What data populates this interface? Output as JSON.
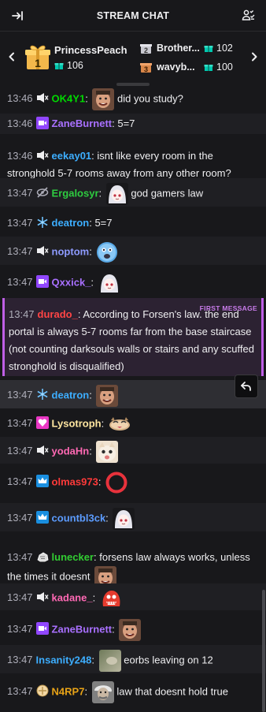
{
  "header": {
    "title": "STREAM CHAT"
  },
  "gifters": {
    "top": {
      "name": "PrincessPeach",
      "count": "106",
      "rank": "1"
    },
    "second": {
      "name": "Brother...",
      "count": "102",
      "rank": "2"
    },
    "third": {
      "name": "wavyb...",
      "count": "100",
      "rank": "3"
    }
  },
  "colors": {
    "accent": "#9147ff",
    "first_message": "#bf5fe6",
    "gift": "#00c8af"
  },
  "messages": [
    {
      "time": "13:46",
      "user": "OK4Y1",
      "user_color": "#00d900",
      "sep": ": ",
      "text": "did you study?",
      "badge": "mute-badge-icon",
      "emote": "face-emote"
    },
    {
      "time": "13:46",
      "user": "ZaneBurnett",
      "user_color": "#a970ff",
      "sep": ": ",
      "text": "5=7",
      "badge": "video-badge-icon"
    },
    {
      "time": "13:46",
      "user": "eekay01",
      "user_color": "#3daeff",
      "sep": ": ",
      "text": "isnt like every room in the stronghold 5-7 rooms away from any other room?",
      "badge": "mute-badge-icon"
    },
    {
      "time": "13:47",
      "user": "Ergalosyr",
      "user_color": "#2ecc40",
      "sep": ": ",
      "text": "god gamers law",
      "badge": "eye-slash-badge-icon",
      "emote": "anime-emote"
    },
    {
      "time": "13:47",
      "user": "deatron",
      "user_color": "#3daeff",
      "sep": ": ",
      "text": "5=7",
      "badge": "snowflake-badge-icon"
    },
    {
      "time": "13:47",
      "user": "noptom",
      "user_color": "#8e9bff",
      "sep": ": ",
      "text": "",
      "badge": "mute-badge-icon",
      "emote": "blue-blob-emote"
    },
    {
      "time": "13:47",
      "user": "Qxxick_",
      "user_color": "#a970ff",
      "sep": ": ",
      "text": "",
      "badge": "video-badge-icon",
      "emote": "anime-emote"
    },
    {
      "time": "13:47",
      "user": "durado_",
      "user_color": "#ff4545",
      "sep": ": ",
      "text": "According to Forsen's law. the end portal is always 5-7 rooms far from the base staircase (not counting darksouls walls or stairs and any scuffed stronghold is disqualified)",
      "badge": "",
      "tag": "FIRST MESSAGE"
    },
    {
      "time": "13:47",
      "user": "deatron",
      "user_color": "#3daeff",
      "sep": ": ",
      "text": "",
      "badge": "snowflake-badge-icon",
      "emote": "face-emote"
    },
    {
      "time": "13:47",
      "user": "Lysotroph",
      "user_color": "#ffe6a0",
      "sep": ": ",
      "text": "",
      "badge": "heart-gem-badge-icon",
      "emote": "cat-emote"
    },
    {
      "time": "13:47",
      "user": "yodaHn",
      "user_color": "#ff69b4",
      "sep": ": ",
      "text": "",
      "badge": "mute-badge-icon",
      "emote": "cat-face-emote"
    },
    {
      "time": "13:47",
      "user": "olmas973",
      "user_color": "#ff3a3a",
      "sep": ": ",
      "text": "",
      "badge": "crown-badge-icon",
      "emote": "red-ring-emote"
    },
    {
      "time": "13:47",
      "user": "countbl3ck",
      "user_color": "#5c9cff",
      "sep": ": ",
      "text": "",
      "badge": "crown-badge-icon",
      "emote": "anime-emote"
    },
    {
      "time": "13:47",
      "user": "lunecker",
      "user_color": "#32cd32",
      "sep": ": ",
      "text": "forsens law always works, unless the times it doesnt",
      "badge": "rock-badge-icon",
      "emote": "face-emote"
    },
    {
      "time": "13:47",
      "user": "kadane_",
      "user_color": "#ff69b4",
      "sep": ": ",
      "text": "",
      "badge": "mute-badge-icon",
      "emote": "red-creature-emote"
    },
    {
      "time": "13:47",
      "user": "ZaneBurnett",
      "user_color": "#a970ff",
      "sep": ": ",
      "text": "",
      "badge": "video-badge-icon",
      "emote": "face-emote"
    },
    {
      "time": "13:47",
      "user": "Insanity248",
      "user_color": "#3daeff",
      "sep": ": ",
      "text": "eorbs leaving on 12",
      "badge": "",
      "emote": "blurry-emote"
    },
    {
      "time": "13:47",
      "user": "N4RP7",
      "user_color": "#e8a317",
      "sep": ": ",
      "text": "law that doesnt hold true",
      "badge": "coin-badge-icon",
      "emote": "einstein-emote"
    }
  ]
}
